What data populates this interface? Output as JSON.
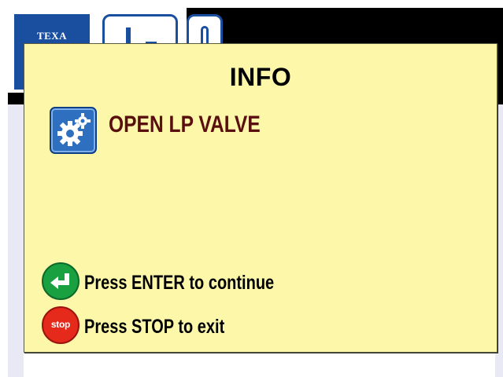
{
  "background": {
    "logo_text": "TEXA"
  },
  "dialog": {
    "title": "INFO",
    "message": "OPEN LP VALVE",
    "message_icon": "gears-icon",
    "hints": {
      "enter": {
        "icon": "enter-arrow-icon",
        "text": "Press ENTER to continue"
      },
      "stop": {
        "icon": "stop-icon",
        "icon_label": "stop",
        "text": "Press STOP to exit"
      }
    }
  },
  "colors": {
    "dialog_background": "#fcf7a9",
    "message_text": "#5a0f0f",
    "enter_button": "#19a040",
    "stop_button": "#e52a1c",
    "brand_blue": "#1a4fa0"
  }
}
